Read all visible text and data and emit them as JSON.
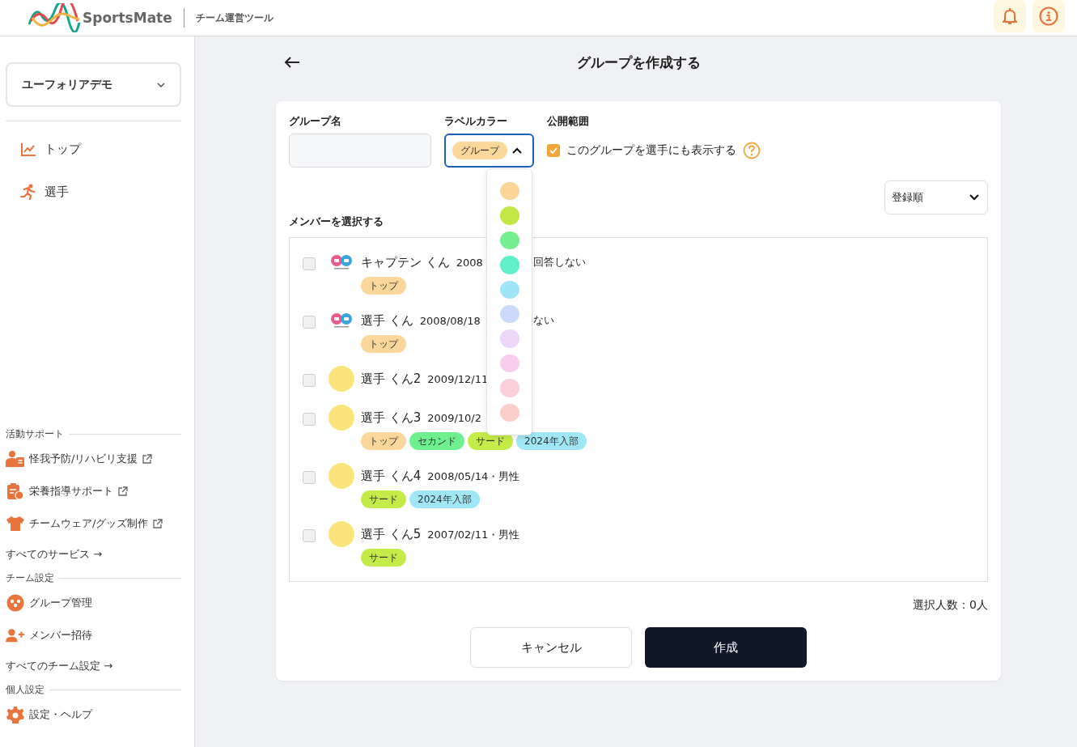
{
  "header": {
    "logo_text": "SportsMate",
    "subtitle": "チーム運営ツール",
    "buttons": [
      {
        "kind": "bell"
      },
      {
        "kind": "info"
      }
    ]
  },
  "sidebar": {
    "team_select": "ユーフォリアデモ",
    "nav": [
      {
        "label": "トップ"
      },
      {
        "label": "選手"
      }
    ],
    "sections": [
      {
        "title": "活動サポート",
        "items": [
          {
            "label": "怪我予防/リハビリ支援",
            "external": true
          },
          {
            "label": "栄養指導サポート",
            "external": true
          },
          {
            "label": "チームウェア/グッズ制作",
            "external": true
          }
        ],
        "link": "すべてのサービス →"
      },
      {
        "title": "チーム設定",
        "items": [
          {
            "label": "グループ管理",
            "external": false
          },
          {
            "label": "メンバー招待",
            "external": false
          }
        ],
        "link": "すべてのチーム設定 →"
      },
      {
        "title": "個人設定",
        "items": [
          {
            "label": "設定・ヘルプ",
            "external": false
          }
        ]
      }
    ]
  },
  "page": {
    "title": "グループを作成する"
  },
  "form": {
    "name_label": "グループ名",
    "color_label": "ラベルカラー",
    "color_value": {
      "label": "グループ",
      "color": "#fcd79b"
    },
    "dropdown_open": true,
    "swatches": [
      {
        "color": "#fbd49a"
      },
      {
        "color": "#c3e845"
      },
      {
        "color": "#74ee8e"
      },
      {
        "color": "#5ef0c8"
      },
      {
        "color": "#a0e4f8"
      },
      {
        "color": "#cdd9fa"
      },
      {
        "color": "#ecd6fa"
      },
      {
        "color": "#f9cdee"
      },
      {
        "color": "#fbcfdc"
      },
      {
        "color": "#fbcfc9"
      }
    ],
    "visibility_label": "公開範囲",
    "visibility_option": {
      "label": "このグループを選手にも表示する",
      "checked": true
    },
    "sort": "登録順",
    "members_label": "メンバーを選択する",
    "members": [
      {
        "name": "キャプテン くん",
        "info": "2008",
        "info_tail": "回答しない",
        "kind": "logo",
        "checked": false,
        "tags": [
          {
            "label": "トップ",
            "color": "#fcd79b"
          }
        ]
      },
      {
        "name": "選手 くん",
        "info": "2008/08/18",
        "info_tail": "ない",
        "kind": "logo",
        "checked": false,
        "tags": [
          {
            "label": "トップ",
            "color": "#fcd79b"
          }
        ]
      },
      {
        "name": "選手 くん2",
        "info": "2009/12/11",
        "kind": "plain",
        "checked": false
      },
      {
        "name": "選手 くん3",
        "info": "2009/10/2",
        "kind": "plain",
        "checked": false,
        "tags": [
          {
            "label": "トップ",
            "color": "#fcd79b"
          },
          {
            "label": "セカンド",
            "color": "#6ef08f"
          },
          {
            "label": "サード",
            "color": "#c4ec48"
          },
          {
            "label": "2024年入部",
            "color": "#9fe6f7"
          }
        ]
      },
      {
        "name": "選手 くん4",
        "info": "2008/05/14・男性",
        "kind": "plain",
        "checked": false,
        "tags": [
          {
            "label": "サード",
            "color": "#c4ec48"
          },
          {
            "label": "2024年入部",
            "color": "#9fe6f7"
          }
        ]
      },
      {
        "name": "選手 くん5",
        "info": "2007/02/11・男性",
        "kind": "plain",
        "checked": false,
        "tags": [
          {
            "label": "サード",
            "color": "#c4ec48"
          }
        ]
      }
    ],
    "selected_count": "選択人数：0人",
    "buttons": [
      {
        "label": "キャンセル",
        "kind": "secondary"
      },
      {
        "label": "作成",
        "kind": "primary"
      }
    ]
  }
}
